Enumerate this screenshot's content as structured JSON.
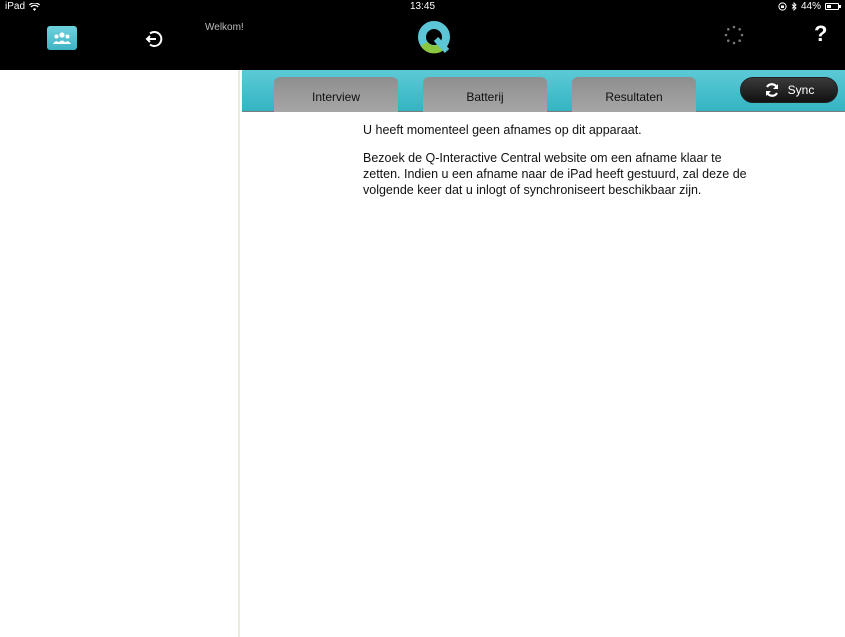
{
  "status_bar": {
    "carrier": "iPad",
    "time": "13:45",
    "battery_percent": "44%",
    "battery_level": 0.44
  },
  "nav": {
    "welcome": "Welkom!",
    "help": "?"
  },
  "tabs": [
    {
      "label": "Interview"
    },
    {
      "label": "Batterij"
    },
    {
      "label": "Resultaten"
    }
  ],
  "sync": {
    "label": "Sync"
  },
  "main": {
    "message": "U heeft momenteel geen afnames op dit apparaat.",
    "instructions": "Bezoek de Q-Interactive Central website om een afname klaar te zetten. Indien u een afname naar de iPad heeft gestuurd, zal deze de volgende keer dat u inlogt of synchroniseert beschikbaar zijn."
  },
  "colors": {
    "accent_teal": "#3fb3c3",
    "tab_gray": "#9a9a9a",
    "nav_black": "#000000"
  },
  "icons": [
    "wifi-icon",
    "users-icon",
    "logout-icon",
    "app-logo",
    "loading-spinner-icon",
    "help-icon",
    "sync-icon",
    "bluetooth-icon",
    "orientation-lock-icon",
    "battery-icon"
  ]
}
